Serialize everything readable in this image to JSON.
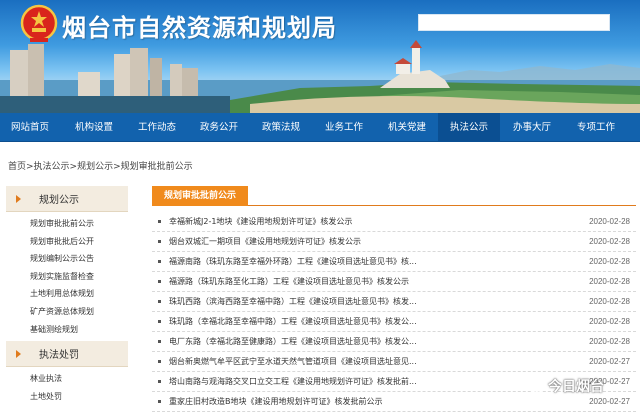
{
  "header": {
    "site_title": "烟台市自然资源和规划局",
    "emblem_icon": "national-emblem-icon",
    "search_placeholder": ""
  },
  "nav": {
    "items": [
      {
        "label": "网站首页"
      },
      {
        "label": "机构设置"
      },
      {
        "label": "工作动态"
      },
      {
        "label": "政务公开"
      },
      {
        "label": "政策法规"
      },
      {
        "label": "业务工作"
      },
      {
        "label": "机关党建"
      },
      {
        "label": "执法公示"
      },
      {
        "label": "办事大厅"
      },
      {
        "label": "专项工作"
      }
    ]
  },
  "breadcrumb": {
    "text": "首页>执法公示>规划公示>规划审批批前公示"
  },
  "sidebar": {
    "section1": {
      "title": "规划公示",
      "items": [
        {
          "label": "规划审批批前公示"
        },
        {
          "label": "规划审批批后公开"
        },
        {
          "label": "规划编制公示公告"
        },
        {
          "label": "规划实施监督检查"
        },
        {
          "label": "土地利用总体规划"
        },
        {
          "label": "矿产资源总体规划"
        },
        {
          "label": "基础测绘规划"
        }
      ]
    },
    "section2": {
      "title": "执法处罚",
      "items": [
        {
          "label": "林业执法"
        },
        {
          "label": "土地处罚"
        }
      ]
    }
  },
  "main": {
    "tab_label": "规划审批批前公示",
    "rows": [
      {
        "title": "幸福新城J2-1地块《建设用地规划许可证》核发公示",
        "date": "2020-02-28"
      },
      {
        "title": "烟台双城汇一期项目《建设用地规划许可证》核发公示",
        "date": "2020-02-28"
      },
      {
        "title": "福源南路（珠玑东路至幸福外环路）工程《建设项目选址意见书》核...",
        "date": "2020-02-28"
      },
      {
        "title": "福源路（珠玑东路至化工路）工程《建设项目选址意见书》核发公示",
        "date": "2020-02-28"
      },
      {
        "title": "珠玑西路（滨海西路至幸福中路）工程《建设项目选址意见书》核发...",
        "date": "2020-02-28"
      },
      {
        "title": "珠玑路（幸福北路至幸福中路）工程《建设项目选址意见书》核发公...",
        "date": "2020-02-28"
      },
      {
        "title": "电厂东路（幸福北路至健康路）工程《建设项目选址意见书》核发公...",
        "date": "2020-02-28"
      },
      {
        "title": "烟台新奥燃气牟平区武宁至水道天然气管道项目《建设项目选址意见...",
        "date": "2020-02-27"
      },
      {
        "title": "塔山南路与观海路交叉口立交工程《建设用地规划许可证》核发批前...",
        "date": "2020-02-27"
      },
      {
        "title": "重家庄旧村改造B地块《建设用地规划许可证》核发批前公示",
        "date": "2020-02-27"
      }
    ]
  },
  "watermark": {
    "text": "今日烟台",
    "icon": "wechat-icon"
  },
  "colors": {
    "nav_bg": "#1262ad",
    "accent_orange": "#f08a1c",
    "sidebar_head_bg": "#f3ece0"
  }
}
